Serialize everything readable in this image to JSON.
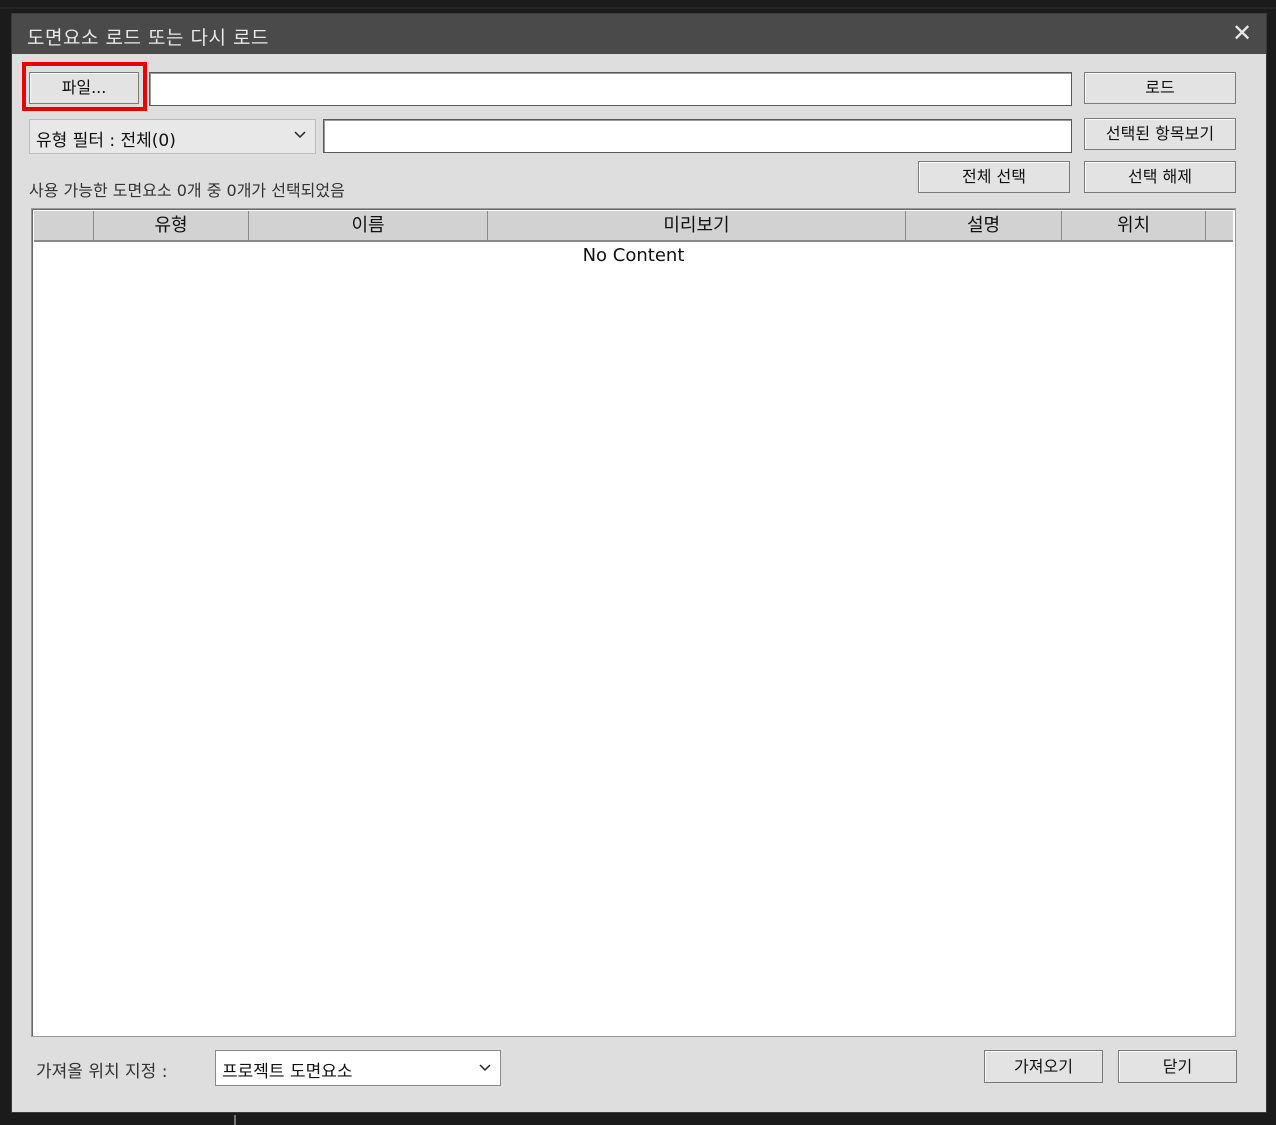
{
  "dialog": {
    "title": "도면요소 로드 또는 다시 로드",
    "close_symbol": "✕"
  },
  "toolbar": {
    "file_button": "파일...",
    "file_path_value": "",
    "load_button": "로드",
    "type_filter_label": "유형 필터 : 전체(0)",
    "filter_text_value": "",
    "show_selected_button": "선택된 항목보기",
    "select_all_button": "전체 선택",
    "deselect_button": "선택 해제",
    "status_text": "사용 가능한 도면요소 0개 중 0개가 선택되었음"
  },
  "table": {
    "columns": [
      "",
      "유형",
      "이름",
      "미리보기",
      "설명",
      "위치"
    ],
    "rows": [],
    "empty_text": "No Content"
  },
  "footer": {
    "destination_label": "가져올 위치 지정 :",
    "destination_value": "프로젝트 도면요소",
    "import_button": "가져오기",
    "close_button": "닫기"
  },
  "icons": {
    "close": "close-icon",
    "dropdown": "chevron-down-icon"
  },
  "colors": {
    "highlight": "#e80000",
    "titlebar": "#4a4a4a",
    "dialog_bg": "#dedede"
  }
}
